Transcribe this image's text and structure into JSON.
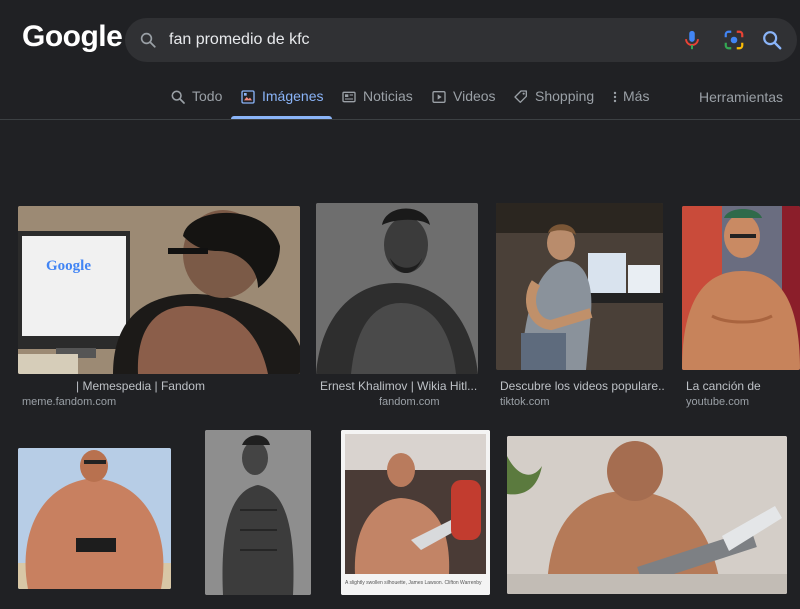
{
  "logo": "Google",
  "search": {
    "query": "fan promedio de kfc"
  },
  "icons": {
    "search": "search-icon",
    "mic": "microphone-icon",
    "lens": "google-lens-icon",
    "submit": "search-submit-icon"
  },
  "tabs": [
    {
      "label": "Todo",
      "icon": "search-icon"
    },
    {
      "label": "Imágenes",
      "icon": "image-icon",
      "active": true
    },
    {
      "label": "Noticias",
      "icon": "newspaper-icon"
    },
    {
      "label": "Videos",
      "icon": "play-icon"
    },
    {
      "label": "Shopping",
      "icon": "tag-icon"
    },
    {
      "label": "Más",
      "icon": "more-vert-icon"
    }
  ],
  "tools_label": "Herramientas",
  "results": [
    {
      "title": "| Memespedia | Fandom",
      "source": "meme.fandom.com",
      "thumb_google_text": "Google"
    },
    {
      "title": "Ernest Khalimov | Wikia Hitl...",
      "source": "fandom.com"
    },
    {
      "title": "Descubre los videos populare...",
      "source": "tiktok.com"
    },
    {
      "title": "La canción de",
      "source": "youtube.com"
    },
    {
      "title": ""
    },
    {
      "title": ""
    },
    {
      "title": "",
      "thumb_caption": "A slightly swollen silhouette, James Lawson. Clifton Warrenby"
    },
    {
      "title": ""
    }
  ]
}
